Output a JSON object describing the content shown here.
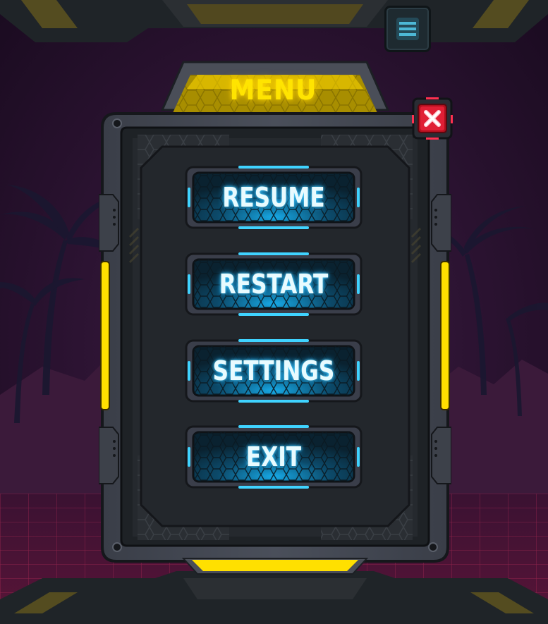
{
  "menu": {
    "title": "MENU",
    "close_icon": "close-x-icon",
    "buttons": [
      {
        "id": "resume",
        "label": "RESUME"
      },
      {
        "id": "restart",
        "label": "RESTART"
      },
      {
        "id": "settings",
        "label": "SETTINGS"
      },
      {
        "id": "exit",
        "label": "EXIT"
      }
    ]
  },
  "hud": {
    "top_right_icon": "menu-list-icon"
  },
  "colors": {
    "accent_yellow": "#ffe400",
    "neon_cyan": "#3fd3ff",
    "close_red": "#e8203a",
    "panel_dark": "#24282f",
    "background": "#2e1434"
  }
}
